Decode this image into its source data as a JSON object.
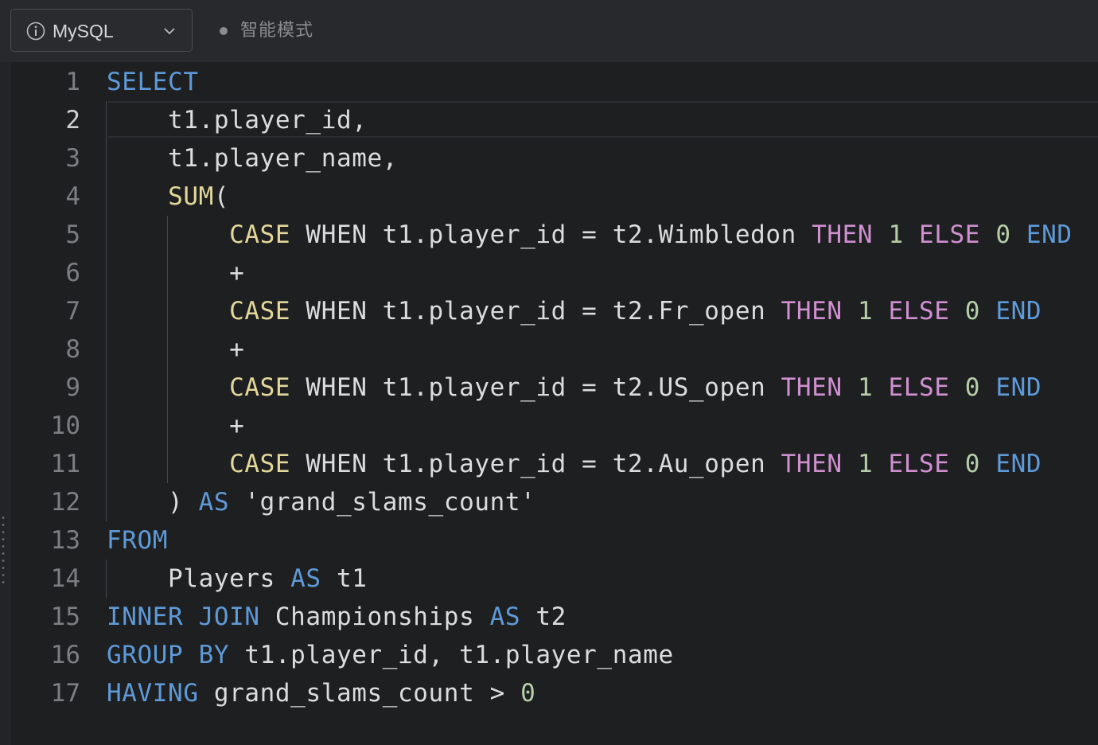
{
  "toolbar": {
    "language": "MySQL",
    "mode_label": "智能模式"
  },
  "editor": {
    "language": "sql",
    "active_line": 2,
    "lines": [
      {
        "n": "1",
        "tokens": [
          {
            "t": "SELECT",
            "c": "kw"
          }
        ]
      },
      {
        "n": "2",
        "tokens": [
          {
            "t": "    t1.player_id,",
            "c": ""
          }
        ]
      },
      {
        "n": "3",
        "tokens": [
          {
            "t": "    t1.player_name,",
            "c": ""
          }
        ]
      },
      {
        "n": "4",
        "tokens": [
          {
            "t": "    ",
            "c": ""
          },
          {
            "t": "SUM",
            "c": "fn"
          },
          {
            "t": "(",
            "c": ""
          }
        ]
      },
      {
        "n": "5",
        "tokens": [
          {
            "t": "        ",
            "c": ""
          },
          {
            "t": "CASE",
            "c": "fn"
          },
          {
            "t": " WHEN t1.player_id = t2.Wimbledon ",
            "c": ""
          },
          {
            "t": "THEN",
            "c": "ctl"
          },
          {
            "t": " ",
            "c": ""
          },
          {
            "t": "1",
            "c": "num"
          },
          {
            "t": " ",
            "c": ""
          },
          {
            "t": "ELSE",
            "c": "ctl"
          },
          {
            "t": " ",
            "c": ""
          },
          {
            "t": "0",
            "c": "num"
          },
          {
            "t": " ",
            "c": ""
          },
          {
            "t": "END",
            "c": "kw"
          }
        ]
      },
      {
        "n": "6",
        "tokens": [
          {
            "t": "        +",
            "c": ""
          }
        ]
      },
      {
        "n": "7",
        "tokens": [
          {
            "t": "        ",
            "c": ""
          },
          {
            "t": "CASE",
            "c": "fn"
          },
          {
            "t": " WHEN t1.player_id = t2.Fr_open ",
            "c": ""
          },
          {
            "t": "THEN",
            "c": "ctl"
          },
          {
            "t": " ",
            "c": ""
          },
          {
            "t": "1",
            "c": "num"
          },
          {
            "t": " ",
            "c": ""
          },
          {
            "t": "ELSE",
            "c": "ctl"
          },
          {
            "t": " ",
            "c": ""
          },
          {
            "t": "0",
            "c": "num"
          },
          {
            "t": " ",
            "c": ""
          },
          {
            "t": "END",
            "c": "kw"
          }
        ]
      },
      {
        "n": "8",
        "tokens": [
          {
            "t": "        +",
            "c": ""
          }
        ]
      },
      {
        "n": "9",
        "tokens": [
          {
            "t": "        ",
            "c": ""
          },
          {
            "t": "CASE",
            "c": "fn"
          },
          {
            "t": " WHEN t1.player_id = t2.US_open ",
            "c": ""
          },
          {
            "t": "THEN",
            "c": "ctl"
          },
          {
            "t": " ",
            "c": ""
          },
          {
            "t": "1",
            "c": "num"
          },
          {
            "t": " ",
            "c": ""
          },
          {
            "t": "ELSE",
            "c": "ctl"
          },
          {
            "t": " ",
            "c": ""
          },
          {
            "t": "0",
            "c": "num"
          },
          {
            "t": " ",
            "c": ""
          },
          {
            "t": "END",
            "c": "kw"
          }
        ]
      },
      {
        "n": "10",
        "tokens": [
          {
            "t": "        +",
            "c": ""
          }
        ]
      },
      {
        "n": "11",
        "tokens": [
          {
            "t": "        ",
            "c": ""
          },
          {
            "t": "CASE",
            "c": "fn"
          },
          {
            "t": " WHEN t1.player_id = t2.Au_open ",
            "c": ""
          },
          {
            "t": "THEN",
            "c": "ctl"
          },
          {
            "t": " ",
            "c": ""
          },
          {
            "t": "1",
            "c": "num"
          },
          {
            "t": " ",
            "c": ""
          },
          {
            "t": "ELSE",
            "c": "ctl"
          },
          {
            "t": " ",
            "c": ""
          },
          {
            "t": "0",
            "c": "num"
          },
          {
            "t": " ",
            "c": ""
          },
          {
            "t": "END",
            "c": "kw"
          }
        ]
      },
      {
        "n": "12",
        "tokens": [
          {
            "t": "    ) ",
            "c": ""
          },
          {
            "t": "AS",
            "c": "kw"
          },
          {
            "t": " 'grand_slams_count'",
            "c": "str"
          }
        ]
      },
      {
        "n": "13",
        "tokens": [
          {
            "t": "FROM",
            "c": "kw"
          }
        ]
      },
      {
        "n": "14",
        "tokens": [
          {
            "t": "    Players ",
            "c": ""
          },
          {
            "t": "AS",
            "c": "kw"
          },
          {
            "t": " t1",
            "c": ""
          }
        ]
      },
      {
        "n": "15",
        "tokens": [
          {
            "t": "INNER JOIN",
            "c": "kw"
          },
          {
            "t": " Championships ",
            "c": ""
          },
          {
            "t": "AS",
            "c": "kw"
          },
          {
            "t": " t2",
            "c": ""
          }
        ]
      },
      {
        "n": "16",
        "tokens": [
          {
            "t": "GROUP BY",
            "c": "kw"
          },
          {
            "t": " t1.player_id, t1.player_name",
            "c": ""
          }
        ]
      },
      {
        "n": "17",
        "tokens": [
          {
            "t": "HAVING",
            "c": "kw"
          },
          {
            "t": " grand_slams_count > ",
            "c": ""
          },
          {
            "t": "0",
            "c": "num"
          }
        ]
      }
    ]
  },
  "colors": {
    "background": "#1e1f21",
    "keyword": "#5e9ad8",
    "function": "#e3d89a",
    "control": "#cf8fd0",
    "number": "#b5cea8"
  }
}
